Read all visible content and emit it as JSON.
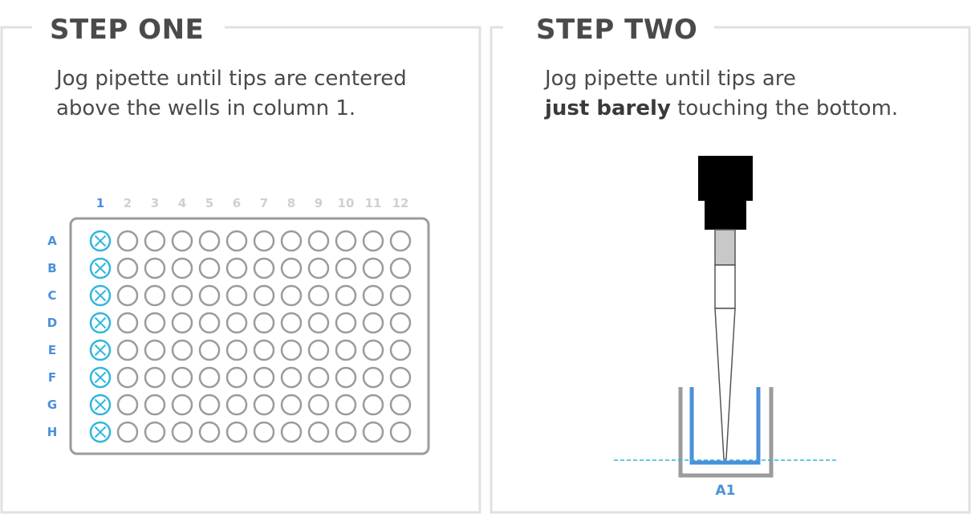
{
  "step_one": {
    "title": "STEP ONE",
    "instruction": "Jog pipette until tips are centered above the wells in column 1."
  },
  "step_two": {
    "title": "STEP TWO",
    "instruction_start": "Jog pipette until tips are",
    "instruction_bold": "just barely",
    "instruction_end": "touching the bottom."
  },
  "plate": {
    "columns": [
      "1",
      "2",
      "3",
      "4",
      "5",
      "6",
      "7",
      "8",
      "9",
      "10",
      "11",
      "12"
    ],
    "rows": [
      "A",
      "B",
      "C",
      "D",
      "E",
      "F",
      "G",
      "H"
    ],
    "highlighted_column": "1"
  },
  "well_label": "A1",
  "colors": {
    "accent_blue": "#4a90d9",
    "highlight_cyan": "#30b6dc",
    "frame_gray": "#e0e0e0",
    "plate_gray": "#9b9b9b",
    "label_gray": "#d0d0d0",
    "text": "#4a4a4a",
    "pipette_black": "#000000",
    "tip_gray": "#c8c8c8"
  }
}
